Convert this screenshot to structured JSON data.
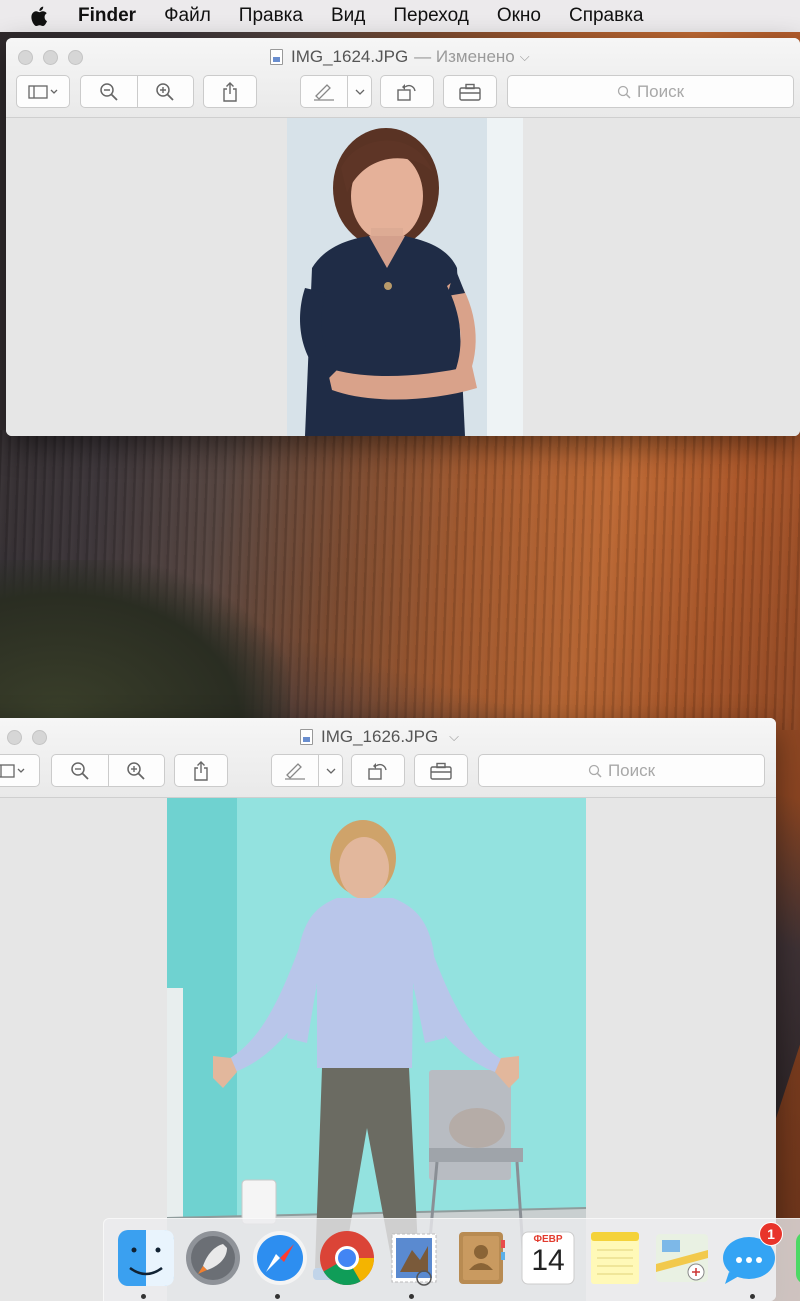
{
  "menubar": {
    "apple_icon": "apple-logo-icon",
    "app_name": "Finder",
    "items": [
      "Файл",
      "Правка",
      "Вид",
      "Переход",
      "Окно",
      "Справка"
    ]
  },
  "windows": [
    {
      "title": "IMG_1624.JPG",
      "status": "— Изменено",
      "search_placeholder": "Поиск",
      "toolbar_icons": [
        "sidebar-icon",
        "zoom-out-icon",
        "zoom-in-icon",
        "share-icon",
        "markup-pen-icon",
        "rotate-icon",
        "toolbox-icon"
      ]
    },
    {
      "title": "IMG_1626.JPG",
      "status": "",
      "search_placeholder": "Поиск",
      "toolbar_icons": [
        "sidebar-icon",
        "zoom-out-icon",
        "zoom-in-icon",
        "share-icon",
        "markup-pen-icon",
        "rotate-icon",
        "toolbox-icon"
      ]
    }
  ],
  "dock": {
    "apps": [
      "Finder",
      "Launchpad",
      "Safari",
      "Chrome",
      "Mail",
      "Contacts",
      "Calendar",
      "Notes",
      "Maps",
      "Messages"
    ],
    "calendar": {
      "month": "ФЕВР",
      "day": "14"
    },
    "messages_badge": "1"
  },
  "colors": {
    "menubar_bg": "#eceaec",
    "window_bg": "#ececec",
    "badge": "#e8342b"
  }
}
